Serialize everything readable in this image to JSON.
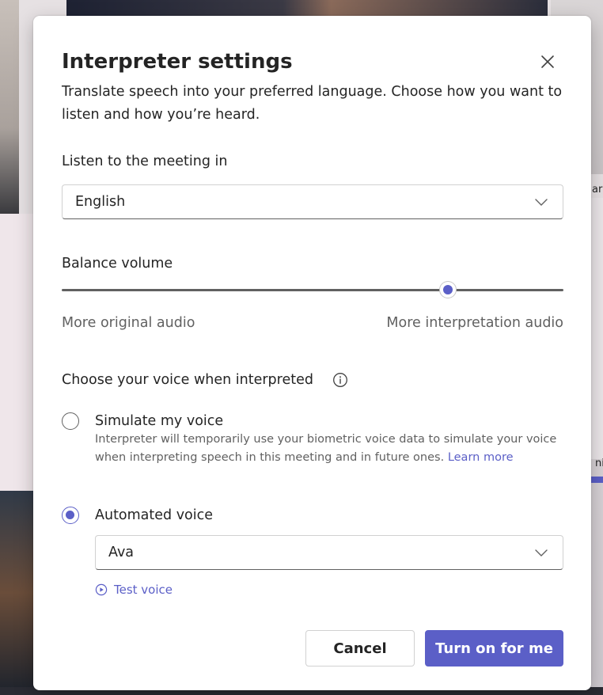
{
  "dialog": {
    "title": "Interpreter settings",
    "description": "Translate speech into your preferred language. Choose how you want to listen and how you’re heard."
  },
  "listen": {
    "label": "Listen to the meeting in",
    "selected_language": "English"
  },
  "balance": {
    "label": "Balance volume",
    "left_hint": "More original audio",
    "right_hint": "More interpretation audio",
    "value_fraction": 0.778
  },
  "voice": {
    "label": "Choose your voice when interpreted",
    "options": [
      {
        "label": "Simulate my voice",
        "selected": false,
        "description": "Interpreter will temporarily use your biometric voice data to simulate your voice when interpreting speech in this meeting and in future ones.",
        "link": "Learn more"
      },
      {
        "label": "Automated voice",
        "selected": true
      }
    ],
    "selected_voice": "Ava",
    "test_voice": "Test voice"
  },
  "buttons": {
    "cancel": "Cancel",
    "confirm": "Turn on for me"
  },
  "background": {
    "edge_text_1": "ar",
    "edge_text_2": "ni"
  },
  "colors": {
    "accent": "#5b5fc7",
    "text": "#242424",
    "muted_text": "#616161"
  }
}
